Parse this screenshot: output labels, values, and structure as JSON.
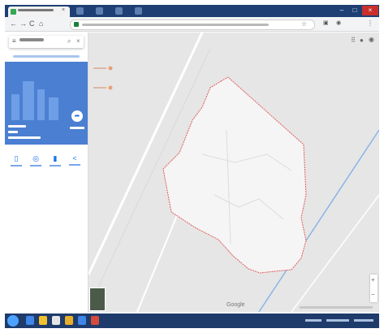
{
  "browser": {
    "tab_icon": "google-maps-icon",
    "close_label": "×",
    "window_controls": [
      "–",
      "□",
      "×"
    ]
  },
  "toolbar": {
    "back": "←",
    "forward": "→",
    "reload": "C",
    "home": "⌂",
    "star": "☆"
  },
  "panel": {
    "menu_icon": "≡",
    "search_icon": "⌕",
    "close_icon": "×",
    "directions_icon": "➦",
    "actions": [
      {
        "icon": "bookmark-icon",
        "glyph": "▯"
      },
      {
        "icon": "nearby-icon",
        "glyph": "◎"
      },
      {
        "icon": "send-to-phone-icon",
        "glyph": "▮"
      },
      {
        "icon": "share-icon",
        "glyph": "<"
      }
    ]
  },
  "map": {
    "attribution": "Google",
    "zoom_in": "+",
    "zoom_out": "−",
    "boundary_color": "#e35b5b",
    "area_fill": "#f5f5f5",
    "marker_color": "#e8a07a"
  },
  "taskbar": {
    "accent": "#1e3b6b"
  }
}
